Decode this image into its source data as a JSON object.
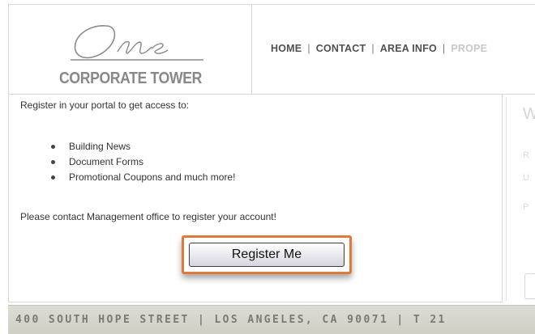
{
  "header": {
    "logo": {
      "script_text": "One",
      "subtitle": "CORPORATE TOWER"
    },
    "nav": {
      "items": [
        "HOME",
        "CONTACT",
        "AREA INFO"
      ],
      "truncated_item": "PROPE",
      "separator": "|"
    }
  },
  "main": {
    "intro": "Register in your portal to get access to:",
    "bullets": [
      "Building News",
      "Document Forms",
      "Promotional Coupons and much more!"
    ],
    "contact_note": "Please contact Management office to register your account!",
    "register_button_label": "Register Me"
  },
  "side_panel": {
    "heading": "W",
    "row_letters": [
      "R",
      "U",
      "P"
    ]
  },
  "footer": {
    "address": "400 SOUTH HOPE STREET | LOS ANGELES, CA 90071 | T 21"
  },
  "colors": {
    "highlight": "#e07a3a",
    "footer_bg": "#d6d6ce",
    "footer_text": "#7a7a72",
    "logo_gray": "#888888"
  }
}
